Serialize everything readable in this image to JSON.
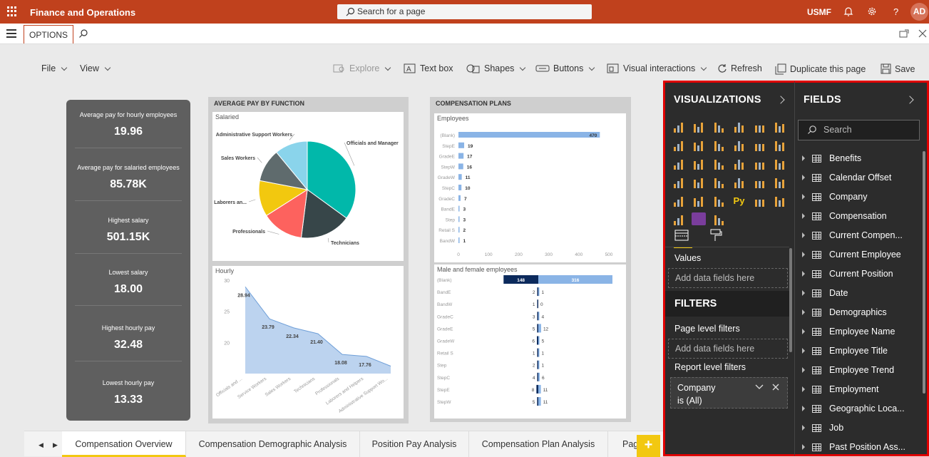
{
  "topbar": {
    "title": "Finance and Operations",
    "search_placeholder": "Search for a page",
    "company": "USMF",
    "avatar": "AD"
  },
  "secbar": {
    "tab_label": "OPTIONS"
  },
  "toolbar": {
    "file": "File",
    "view": "View",
    "explore": "Explore",
    "textbox": "Text box",
    "shapes": "Shapes",
    "buttons": "Buttons",
    "visual_interactions": "Visual interactions",
    "refresh": "Refresh",
    "duplicate": "Duplicate this page",
    "save": "Save"
  },
  "kpis": [
    {
      "label": "Average pay for hourly employees",
      "value": "19.96"
    },
    {
      "label": "Average pay for salaried employees",
      "value": "85.78K"
    },
    {
      "label": "Highest salary",
      "value": "501.15K"
    },
    {
      "label": "Lowest salary",
      "value": "18.00"
    },
    {
      "label": "Highest hourly pay",
      "value": "32.48"
    },
    {
      "label": "Lowest hourly pay",
      "value": "13.33"
    }
  ],
  "avg_pay_panel": {
    "title": "AVERAGE PAY BY FUNCTION",
    "salaried_title": "Salaried",
    "hourly_title": "Hourly"
  },
  "comp_panel": {
    "title": "COMPENSATION PLANS",
    "employees_title": "Employees",
    "gender_title": "Male and female employees"
  },
  "chart_data": [
    {
      "type": "pie",
      "title": "Salaried",
      "categories": [
        "Officials and Manager",
        "Technicians",
        "Professionals",
        "Laborers an...",
        "Sales Workers",
        "Administrative Support Workers"
      ],
      "values": [
        35,
        17,
        14,
        12,
        11,
        11
      ],
      "colors": [
        "#01b8aa",
        "#374649",
        "#fd625e",
        "#f2c80f",
        "#5f6b6d",
        "#8ad4eb"
      ]
    },
    {
      "type": "area",
      "title": "Hourly",
      "categories": [
        "Officials and ...",
        "Service Workers",
        "Sales Workers",
        "Technicians",
        "Professionals",
        "Laborers and Helpers",
        "Administrative Support Wo..."
      ],
      "values": [
        28.94,
        23.79,
        22.34,
        21.4,
        18.08,
        17.76,
        16.2
      ],
      "labels": [
        "28.94",
        "23.79",
        "22.34",
        "21.40",
        "18.08",
        "17.76",
        ""
      ],
      "yticks": [
        "30",
        "25",
        "20"
      ],
      "ylim": [
        15,
        30
      ]
    },
    {
      "type": "bar",
      "title": "Employees",
      "categories": [
        "(Blank)",
        "StepE",
        "GradeE",
        "StepW",
        "GradeW",
        "StepC",
        "GradeC",
        "BandE",
        "Step",
        "Retail S",
        "BandW"
      ],
      "values": [
        470,
        19,
        17,
        16,
        11,
        10,
        7,
        3,
        3,
        2,
        1
      ],
      "xticks": [
        "0",
        "100",
        "200",
        "300",
        "400",
        "500"
      ],
      "xlim": [
        0,
        500
      ]
    },
    {
      "type": "bar",
      "title": "Male and female employees",
      "categories": [
        "(Blank)",
        "BandE",
        "BandW",
        "GradeC",
        "GradeE",
        "GradeW",
        "Retail S",
        "Step",
        "StepC",
        "StepE",
        "StepW"
      ],
      "series": [
        {
          "values": [
            148,
            2,
            1,
            3,
            5,
            6,
            1,
            2,
            4,
            8,
            5
          ]
        },
        {
          "values": [
            316,
            1,
            0,
            4,
            12,
            5,
            1,
            1,
            6,
            11,
            11
          ]
        }
      ]
    }
  ],
  "tabs": {
    "items": [
      "Compensation Overview",
      "Compensation Demographic Analysis",
      "Position Pay Analysis",
      "Compensation Plan Analysis",
      "Pag"
    ],
    "plus": "+"
  },
  "visualizations": {
    "title": "VISUALIZATIONS",
    "values_label": "Values",
    "values_drop": "Add data fields here",
    "filters_title": "FILTERS",
    "page_filters": "Page level filters",
    "page_filters_drop": "Add data fields here",
    "report_filters": "Report level filters",
    "filter_card_field": "Company",
    "filter_card_value": "is (All)"
  },
  "fields": {
    "title": "FIELDS",
    "search_placeholder": "Search",
    "items": [
      "Benefits",
      "Calendar Offset",
      "Company",
      "Compensation",
      "Current Compen...",
      "Current Employee",
      "Current Position",
      "Date",
      "Demographics",
      "Employee Name",
      "Employee Title",
      "Employee Trend",
      "Employment",
      "Geographic Loca...",
      "Job",
      "Past Position Ass..."
    ]
  }
}
